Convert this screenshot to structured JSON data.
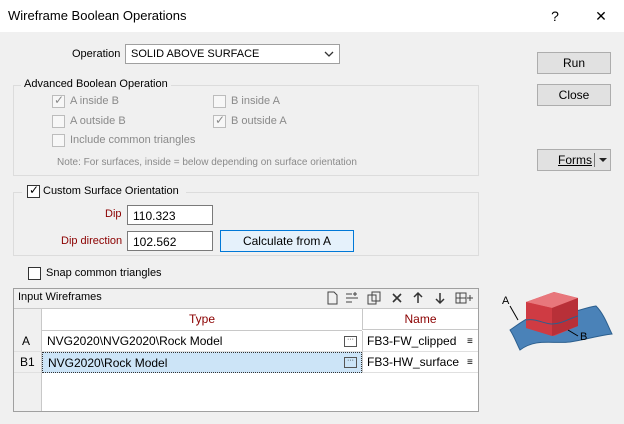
{
  "window": {
    "title": "Wireframe Boolean Operations",
    "help": "?",
    "close": "✕"
  },
  "operation": {
    "label": "Operation",
    "value": "SOLID ABOVE SURFACE"
  },
  "advanced": {
    "legend": "Advanced Boolean Operation",
    "a_inside_b": "A inside B",
    "b_inside_a": "B inside A",
    "a_outside_b": "A outside B",
    "b_outside_a": "B outside A",
    "include_common": "Include common triangles",
    "note": "Note: For surfaces, inside = below depending on surface orientation"
  },
  "orientation": {
    "label": "Custom Surface Orientation",
    "dip_label": "Dip",
    "dip_value": "110.323",
    "dipdir_label": "Dip direction",
    "dipdir_value": "102.562",
    "calc_button": "Calculate from A"
  },
  "snap": {
    "label": "Snap common triangles"
  },
  "buttons": {
    "run": "Run",
    "close": "Close",
    "forms": "Forms"
  },
  "wireframes": {
    "title": "Input Wireframes",
    "col_type": "Type",
    "col_name": "Name",
    "rows": [
      {
        "id": "A",
        "type": "NVG2020\\NVG2020\\Rock Model",
        "name": "FB3-FW_clipped"
      },
      {
        "id": "B1",
        "type": "NVG2020\\Rock Model",
        "name": "FB3-HW_surface"
      }
    ]
  },
  "diagram": {
    "label_a": "A",
    "label_b": "B"
  },
  "colors": {
    "selected_row": "#cce4f7",
    "label_red": "#8b0000",
    "solid": "#d9424a",
    "surface": "#3c78b4"
  }
}
